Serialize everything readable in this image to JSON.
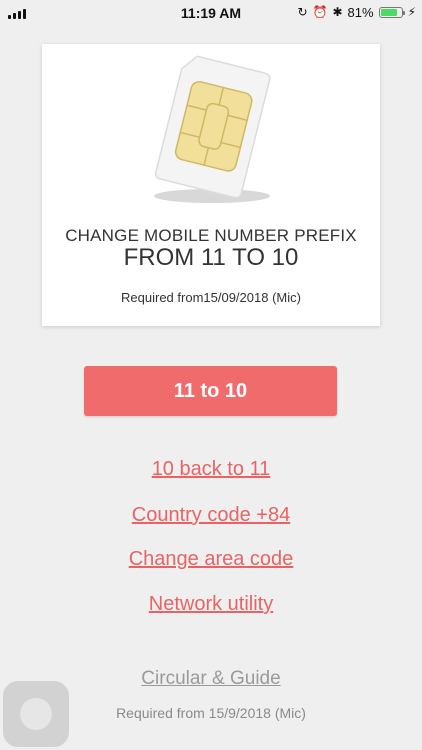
{
  "status_bar": {
    "time": "11:19 AM",
    "battery_percent": "81%",
    "battery_level": 0.81,
    "icons": [
      "signal-icon",
      "screen-lock-icon",
      "alarm-icon",
      "bluetooth-icon",
      "battery-icon",
      "charging-icon"
    ]
  },
  "card": {
    "image": "sim-card-icon",
    "title": "CHANGE MOBILE NUMBER PREFIX",
    "subtitle": "FROM 11 TO 10",
    "note": "Required from15/09/2018 (Mic)"
  },
  "main_button": {
    "label": "11 to 10"
  },
  "links": {
    "back": "10 back to 11",
    "country": "Country code +84",
    "area": "Change area code",
    "network": "Network utility",
    "guide": "Circular & Guide"
  },
  "footer": {
    "note": "Required from 15/9/2018 (Mic)"
  },
  "colors": {
    "accent": "#f06b6b",
    "link": "#e86464",
    "background": "#efefef"
  }
}
